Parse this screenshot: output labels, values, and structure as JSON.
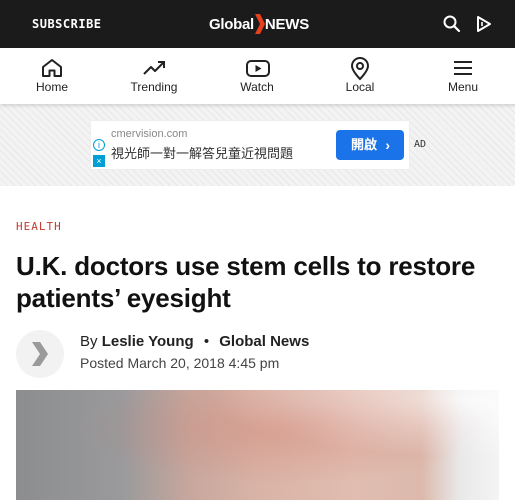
{
  "header": {
    "subscribe_label": "SUBSCRIBE",
    "logo_global": "Global",
    "logo_news": "NEWS",
    "brand_colors": {
      "bar": "#1b1b1b",
      "accent": "#e8401c"
    },
    "icons": [
      "search-icon",
      "play-icon"
    ]
  },
  "nav": {
    "items": [
      {
        "label": "Home",
        "icon": "home-icon"
      },
      {
        "label": "Trending",
        "icon": "trending-icon"
      },
      {
        "label": "Watch",
        "icon": "watch-icon"
      },
      {
        "label": "Local",
        "icon": "location-pin-icon"
      },
      {
        "label": "Menu",
        "icon": "menu-icon"
      }
    ]
  },
  "ad": {
    "domain": "cmervision.com",
    "text": "視光師一對一解答兒童近視問題",
    "button_label": "開啟",
    "label": "AD",
    "info_glyph": "i",
    "close_glyph": "×"
  },
  "article": {
    "category": "HEALTH",
    "headline": "U.K. doctors use stem cells to restore patients’ eyesight",
    "byline_prefix": "By",
    "author": "Leslie Young",
    "separator": "•",
    "source": "Global News",
    "posted": "Posted March 20, 2018 4:45 pm",
    "category_color": "#c63a2e"
  }
}
